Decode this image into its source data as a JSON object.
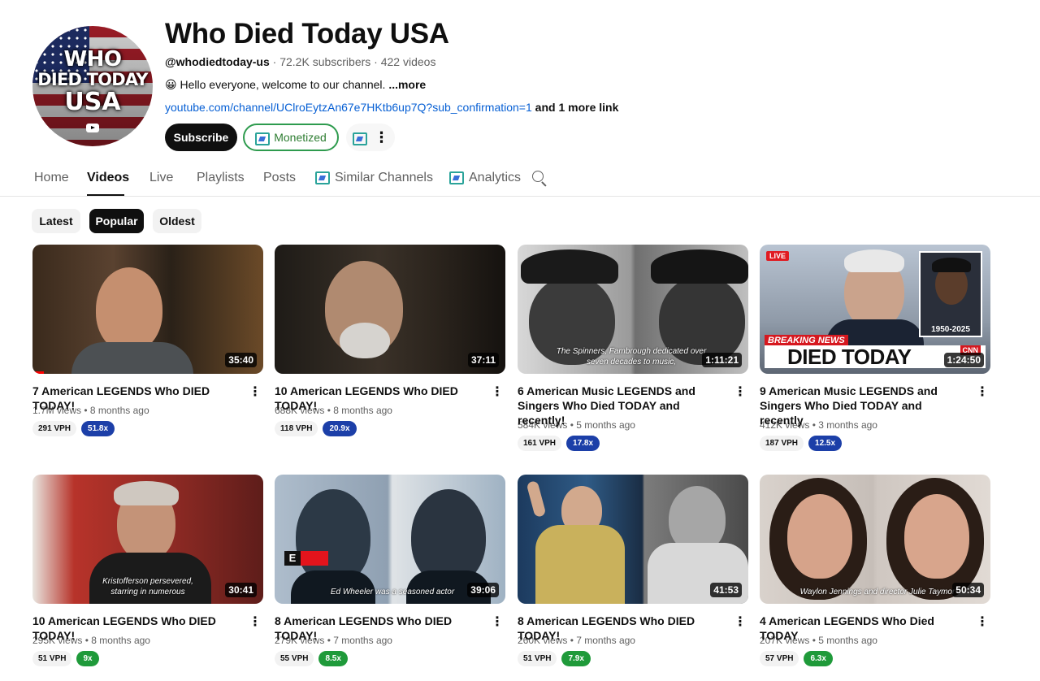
{
  "channel": {
    "avatar_text": [
      "WHO",
      "DIED TODAY",
      "USA"
    ],
    "title": "Who Died Today USA",
    "handle": "@whodiedtoday-us",
    "subscribers": "72.2K subscribers",
    "videos_count": "422 videos",
    "separator": "·",
    "description_emoji": "😀",
    "description": "Hello everyone, welcome to our channel.",
    "description_more": "...more",
    "link": "youtube.com/channel/UClroEytzAn67e7HKtb6up7Q?sub_confirmation=1",
    "more_links": "and 1 more link",
    "subscribe_label": "Subscribe",
    "monetized_label": "Monetized"
  },
  "tabs": [
    {
      "label": "Home"
    },
    {
      "label": "Videos"
    },
    {
      "label": "Live"
    },
    {
      "label": "Playlists"
    },
    {
      "label": "Posts"
    },
    {
      "label": "Similar Channels"
    },
    {
      "label": "Analytics"
    }
  ],
  "active_tab": "Videos",
  "filters": [
    {
      "label": "Latest"
    },
    {
      "label": "Popular"
    },
    {
      "label": "Oldest"
    }
  ],
  "active_filter": "Popular",
  "colors": {
    "link": "#065fd4",
    "monetized_green": "#2e9b4e",
    "badge_blue": "#1c3fa8",
    "badge_green": "#1f9a3a"
  },
  "videos": [
    {
      "title": "7 American LEGENDS Who DIED TODAY!",
      "views": "1.7M views",
      "age": "8 months ago",
      "duration": "35:40",
      "vph": "291 VPH",
      "multiplier": "51.8x",
      "badge_color": "blue",
      "caption": "",
      "watched_fraction": 0.05
    },
    {
      "title": "10 American LEGENDS Who DIED TODAY!",
      "views": "688K views",
      "age": "8 months ago",
      "duration": "37:11",
      "vph": "118 VPH",
      "multiplier": "20.9x",
      "badge_color": "blue",
      "caption": ""
    },
    {
      "title": "6 American Music LEGENDS and Singers Who Died TODAY and recently!",
      "views": "584K views",
      "age": "5 months ago",
      "duration": "1:11:21",
      "vph": "161 VPH",
      "multiplier": "17.8x",
      "badge_color": "blue",
      "caption": "The Spinners, Fambrough dedicated over seven decades to music,"
    },
    {
      "title": "9 American Music LEGENDS and Singers Who Died TODAY and recently",
      "views": "412K views",
      "age": "3 months ago",
      "duration": "1:24:50",
      "vph": "187 VPH",
      "multiplier": "12.5x",
      "badge_color": "blue",
      "caption": "",
      "thumb_text": {
        "live": "LIVE",
        "breaking": "BREAKING NEWS",
        "headline": "DIED TODAY",
        "years": "1950-2025",
        "network": "CNN"
      }
    },
    {
      "title": "10 American LEGENDS Who DIED TODAY!",
      "views": "295K views",
      "age": "8 months ago",
      "duration": "30:41",
      "vph": "51 VPH",
      "multiplier": "9x",
      "badge_color": "green",
      "caption": "Kristofferson persevered, starring in numerous"
    },
    {
      "title": "8 American LEGENDS Who DIED TODAY!",
      "views": "279K views",
      "age": "7 months ago",
      "duration": "39:06",
      "vph": "55 VPH",
      "multiplier": "8.5x",
      "badge_color": "green",
      "caption": "Ed Wheeler was a seasoned actor",
      "thumb_text": {
        "letter": "E"
      }
    },
    {
      "title": "8 American LEGENDS Who DIED TODAY!",
      "views": "260K views",
      "age": "7 months ago",
      "duration": "41:53",
      "vph": "51 VPH",
      "multiplier": "7.9x",
      "badge_color": "green",
      "caption": ""
    },
    {
      "title": "4 American LEGENDS Who Died TODAY",
      "views": "207K views",
      "age": "5 months ago",
      "duration": "50:34",
      "vph": "57 VPH",
      "multiplier": "6.3x",
      "badge_color": "green",
      "caption": "Waylon Jennings and director Julie Taymor"
    }
  ]
}
